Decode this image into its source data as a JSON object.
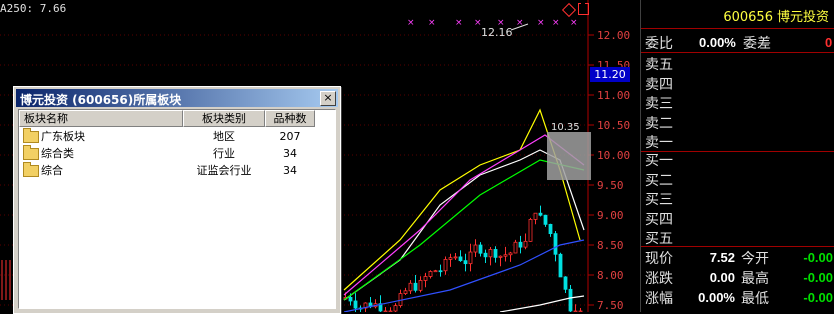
{
  "chart": {
    "ma_label": "A250: 7.66",
    "high_annotation": "12.16",
    "marker_price": "10.35",
    "price_box": "11.20",
    "axis_ticks": [
      "12.00",
      "11.50",
      "11.00",
      "10.50",
      "10.00",
      "9.50",
      "9.00",
      "8.50",
      "8.00",
      "7.50"
    ],
    "icons": [
      "diamond-icon",
      "window-icon"
    ]
  },
  "panel": {
    "code": "600656",
    "name": "博元投资",
    "weibi_label": "委比",
    "weibi_value": "0.00%",
    "weicha_label": "委差",
    "weicha_value": "0",
    "asks": [
      "卖五",
      "卖四",
      "卖三",
      "卖二",
      "卖一"
    ],
    "bids": [
      "买一",
      "买二",
      "买三",
      "买四",
      "买五"
    ],
    "stats": [
      {
        "label": "现价",
        "value": "7.52",
        "label2": "今开",
        "value2": "-0.00"
      },
      {
        "label": "涨跌",
        "value": "0.00",
        "label2": "最高",
        "value2": "-0.00"
      },
      {
        "label": "涨幅",
        "value": "0.00%",
        "label2": "最低",
        "value2": "-0.00"
      }
    ]
  },
  "dialog": {
    "title": "博元投资 (600656)所属板块",
    "close": "×",
    "columns": [
      "板块名称",
      "板块类别",
      "品种数"
    ],
    "rows": [
      {
        "name": "广东板块",
        "type": "地区",
        "count": "207"
      },
      {
        "name": "综合类",
        "type": "行业",
        "count": "34"
      },
      {
        "name": "综合",
        "type": "证监会行业",
        "count": "34"
      }
    ]
  }
}
